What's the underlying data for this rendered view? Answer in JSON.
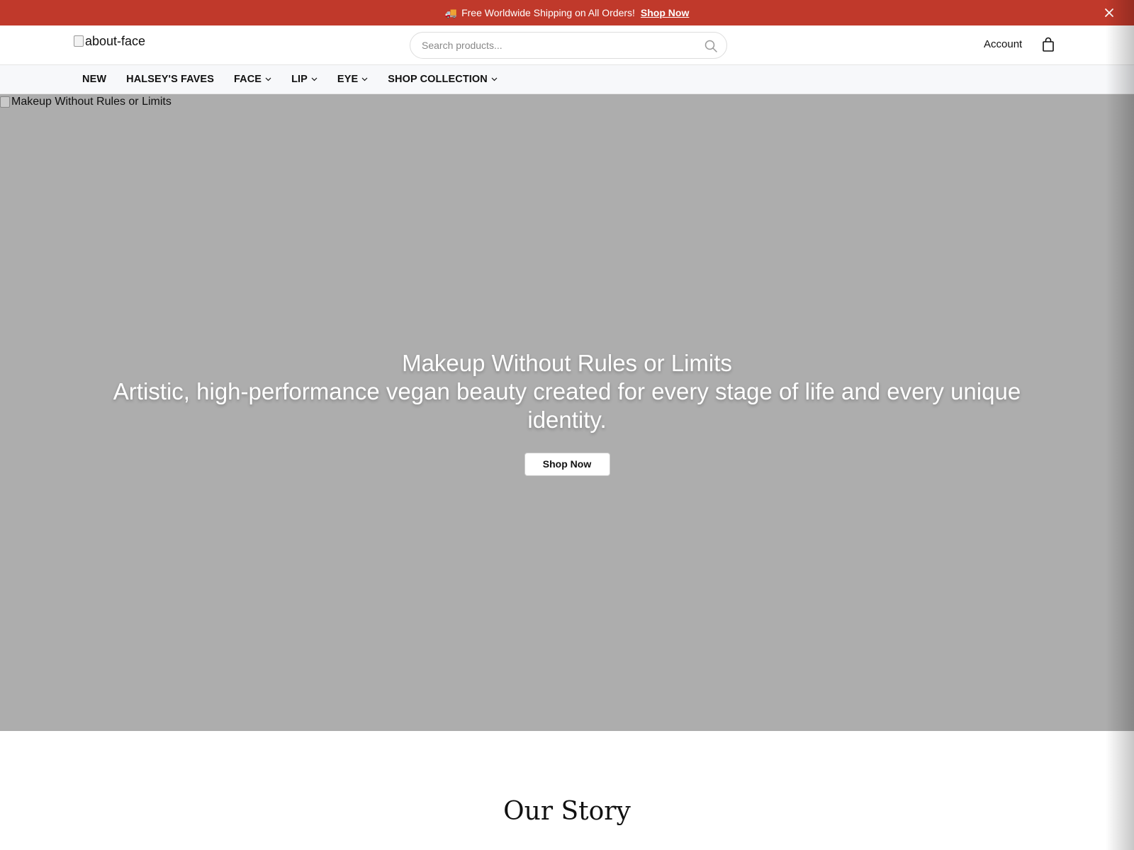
{
  "announcement": {
    "icon": "truck-icon",
    "text": "Free Worldwide Shipping on All Orders!",
    "cta": "Shop Now",
    "background": "#c0392b"
  },
  "header": {
    "logo_alt": "about-face",
    "search": {
      "placeholder": "Search products...",
      "value": ""
    },
    "account_label": "Account"
  },
  "nav": {
    "items": [
      {
        "label": "NEW"
      },
      {
        "label": "HALSEY'S FAVES"
      },
      {
        "label": "FACE"
      },
      {
        "label": "LIP"
      },
      {
        "label": "EYE"
      },
      {
        "label": "SHOP COLLECTION"
      }
    ]
  },
  "hero": {
    "image_alt": "Makeup Without Rules or Limits",
    "title": "Makeup Without Rules or Limits",
    "subtitle": "Artistic, high-performance vegan beauty created for every stage of life and every unique identity.",
    "button_label": "Shop Now",
    "background": "#adadad"
  },
  "story": {
    "title": "Our Story"
  }
}
